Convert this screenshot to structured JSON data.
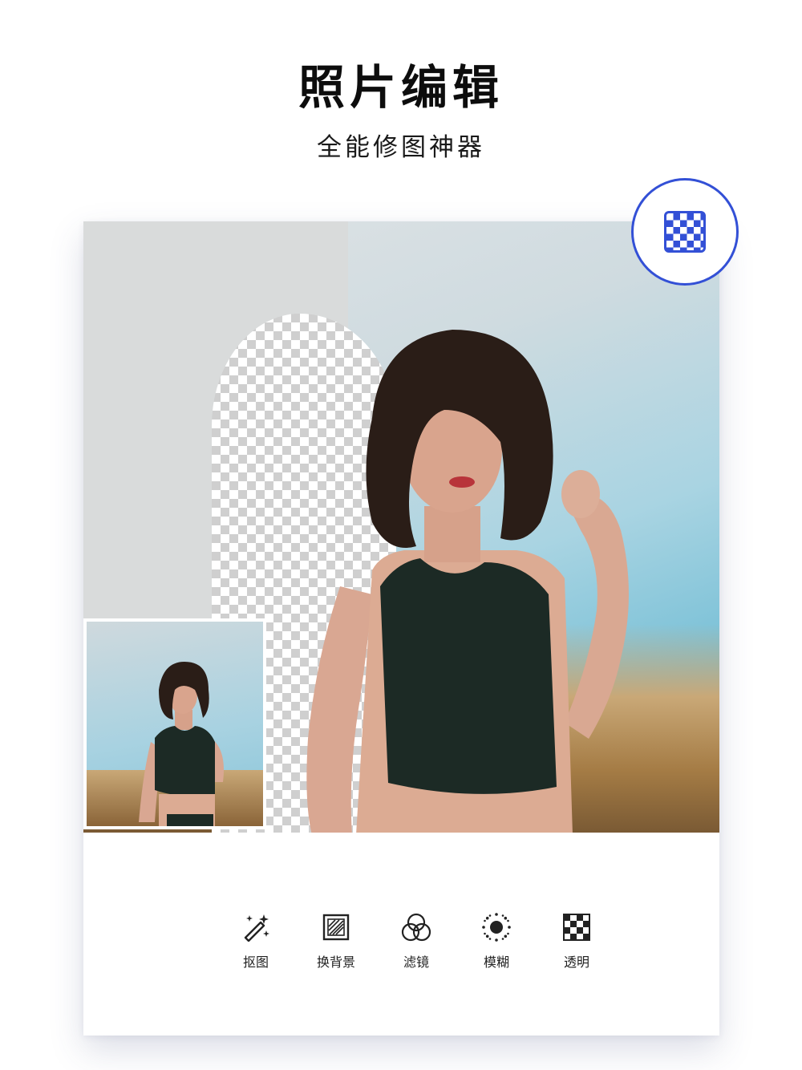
{
  "header": {
    "title": "照片编辑",
    "subtitle": "全能修图神器"
  },
  "colors": {
    "accent": "#3350d6",
    "text": "#111111",
    "card_bg": "#ffffff"
  },
  "transparent_badge": {
    "icon": "checkerboard-icon"
  },
  "toolbar": {
    "items": [
      {
        "label": "抠图",
        "icon": "magic-wand-icon"
      },
      {
        "label": "换背景",
        "icon": "background-swap-icon"
      },
      {
        "label": "滤镜",
        "icon": "filter-circles-icon"
      },
      {
        "label": "模糊",
        "icon": "blur-dot-icon"
      },
      {
        "label": "透明",
        "icon": "transparency-grid-icon"
      }
    ]
  }
}
